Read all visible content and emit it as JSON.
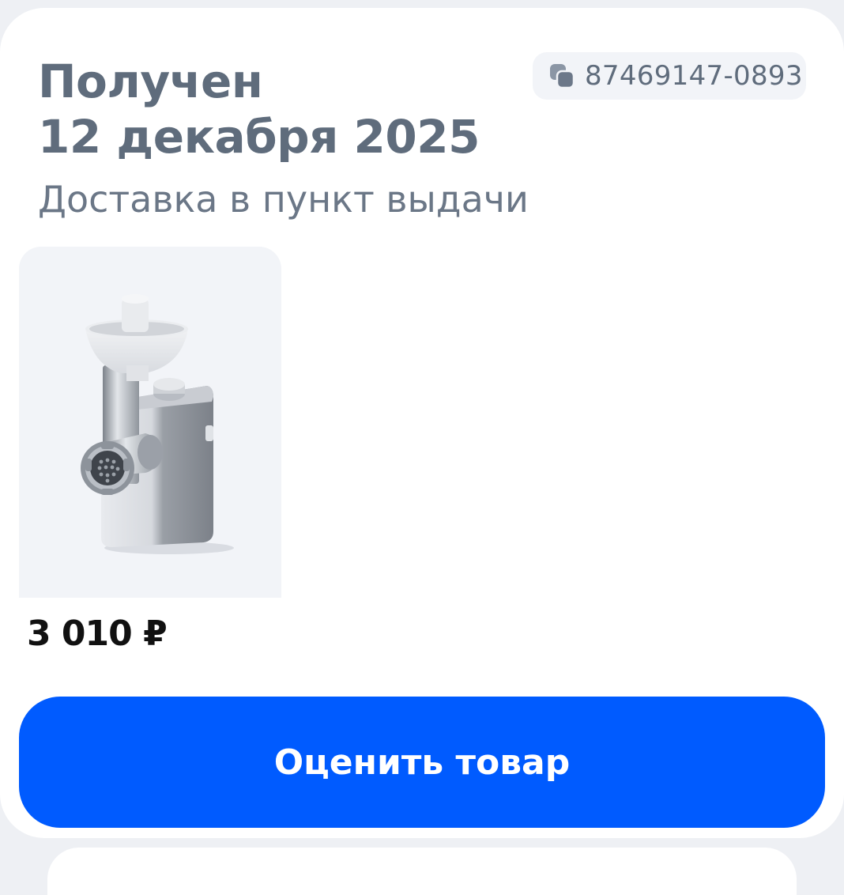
{
  "order": {
    "status_line1": "Получен",
    "status_line2": "12 декабря 2025",
    "delivery_type": "Доставка в пункт выдачи",
    "number": "87469147-0893",
    "copy_icon": "copy-icon"
  },
  "product": {
    "image_icon": "meat-grinder",
    "price": "3 010 ₽"
  },
  "actions": {
    "rate_label": "Оценить товар"
  },
  "colors": {
    "accent": "#005bff",
    "title": "#5f6c7c",
    "background": "#eef0f4"
  }
}
